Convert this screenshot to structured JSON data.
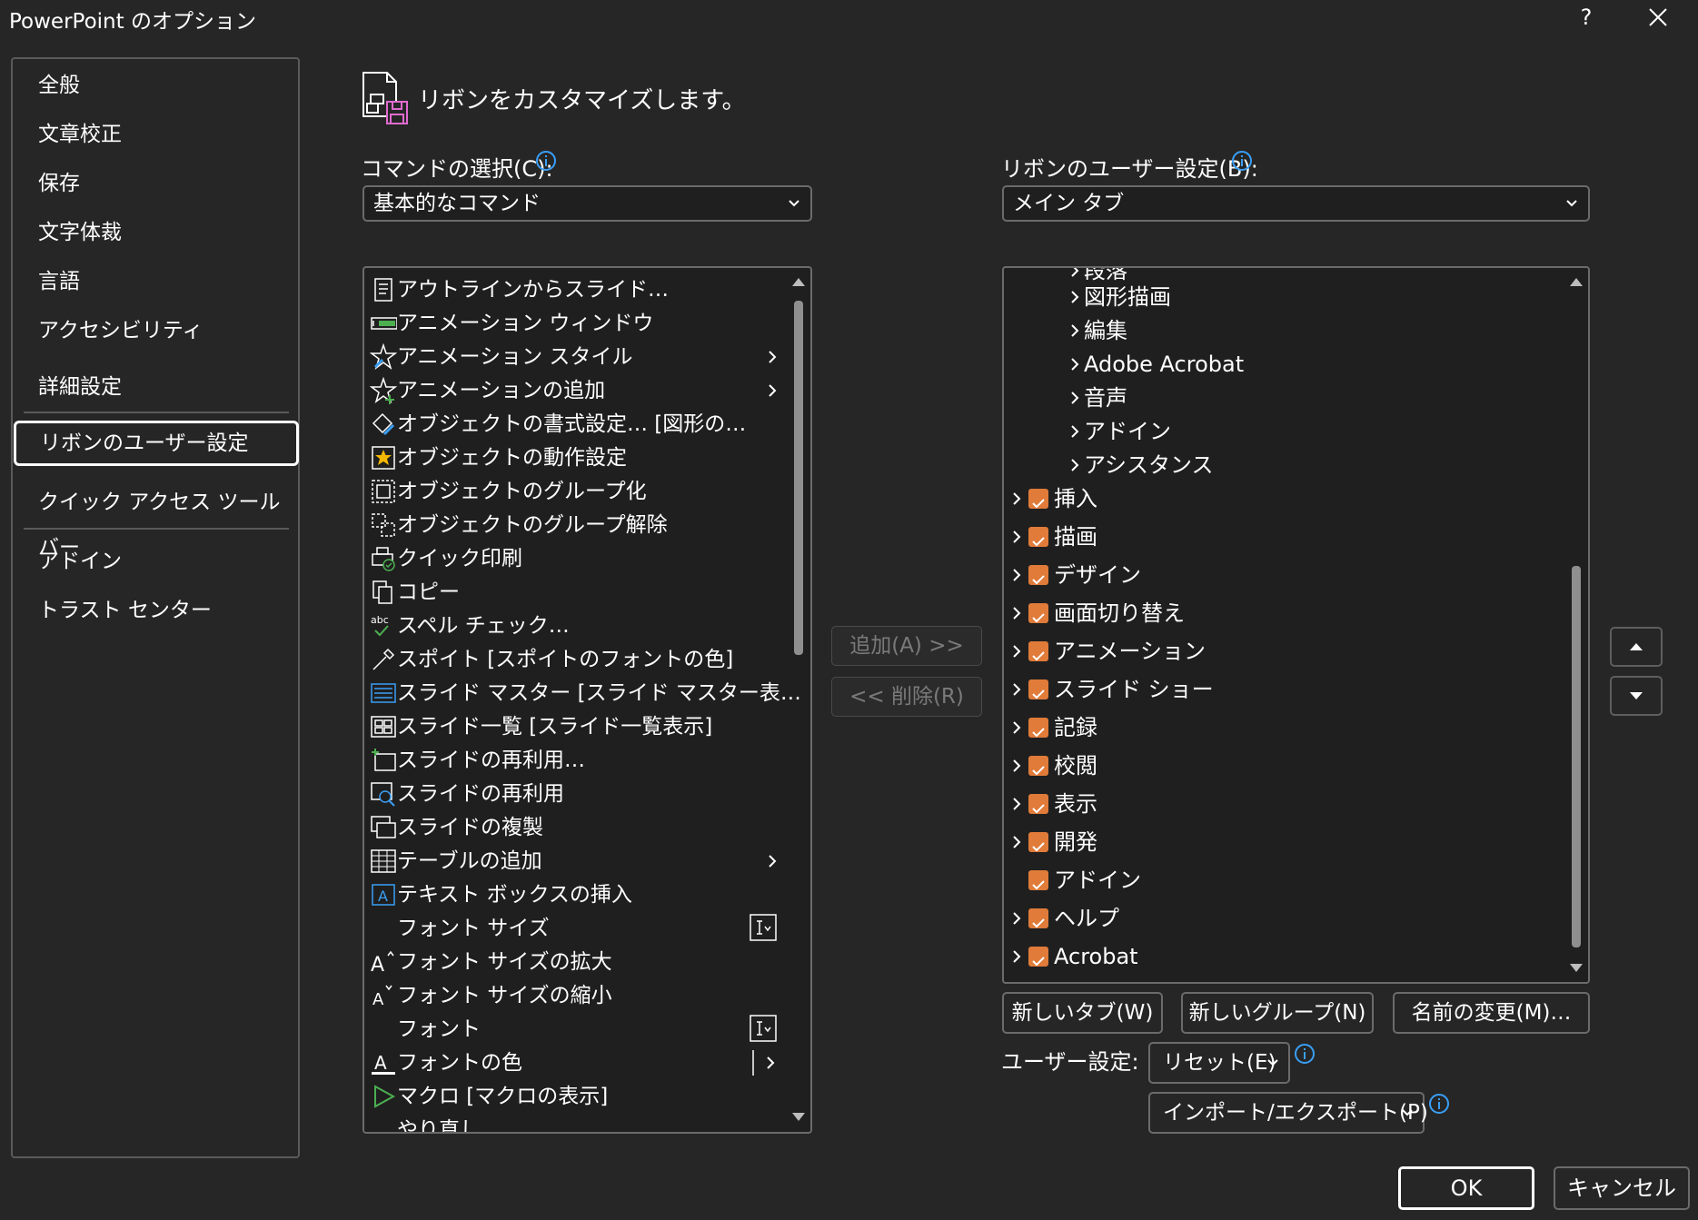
{
  "window": {
    "title": "PowerPoint のオプション",
    "help_label": "?"
  },
  "nav": {
    "items": [
      {
        "label": "全般"
      },
      {
        "label": "文章校正"
      },
      {
        "label": "保存"
      },
      {
        "label": "文字体裁"
      },
      {
        "label": "言語"
      },
      {
        "label": "アクセシビリティ"
      },
      {
        "label": "詳細設定"
      },
      {
        "label": "リボンのユーザー設定",
        "selected": true
      },
      {
        "label": "クイック アクセス ツール バー"
      },
      {
        "label": "アドイン"
      },
      {
        "label": "トラスト センター"
      }
    ]
  },
  "header": {
    "title": "リボンをカスタマイズします。"
  },
  "commands": {
    "label": "コマンドの選択(C):",
    "dropdown_value": "基本的なコマンド",
    "items": [
      {
        "label": "アウトラインからスライド…",
        "icon": "outline-icon"
      },
      {
        "label": "アニメーション ウィンドウ",
        "icon": "animation-pane-icon"
      },
      {
        "label": "アニメーション スタイル",
        "icon": "animation-style-icon",
        "submenu": true
      },
      {
        "label": "アニメーションの追加",
        "icon": "add-animation-icon",
        "submenu": true
      },
      {
        "label": "オブジェクトの書式設定… [図形の…",
        "icon": "format-object-icon"
      },
      {
        "label": "オブジェクトの動作設定",
        "icon": "action-icon"
      },
      {
        "label": "オブジェクトのグループ化",
        "icon": "group-icon"
      },
      {
        "label": "オブジェクトのグループ解除",
        "icon": "ungroup-icon"
      },
      {
        "label": "クイック印刷",
        "icon": "quick-print-icon"
      },
      {
        "label": "コピー",
        "icon": "copy-icon"
      },
      {
        "label": "スペル チェック…",
        "icon": "spellcheck-icon"
      },
      {
        "label": "スポイト [スポイトのフォントの色]",
        "icon": "eyedropper-icon"
      },
      {
        "label": "スライド マスター [スライド マスター表…",
        "icon": "slide-master-icon"
      },
      {
        "label": "スライド一覧 [スライド一覧表示]",
        "icon": "slide-sorter-icon"
      },
      {
        "label": "スライドの再利用…",
        "icon": "reuse-slides-icon"
      },
      {
        "label": "スライドの再利用",
        "icon": "reuse-slides-search-icon"
      },
      {
        "label": "スライドの複製",
        "icon": "duplicate-slide-icon"
      },
      {
        "label": "テーブルの追加",
        "icon": "table-icon",
        "submenu": true
      },
      {
        "label": "テキスト ボックスの挿入",
        "icon": "textbox-icon"
      },
      {
        "label": "フォント サイズ",
        "icon": "",
        "fieldbox": true
      },
      {
        "label": "フォント サイズの拡大",
        "icon": "font-grow-icon"
      },
      {
        "label": "フォント サイズの縮小",
        "icon": "font-shrink-icon"
      },
      {
        "label": "フォント",
        "icon": "",
        "fieldbox": true
      },
      {
        "label": "フォントの色",
        "icon": "font-color-icon",
        "split": true
      },
      {
        "label": "マクロ [マクロの表示]",
        "icon": "macro-icon"
      },
      {
        "label": "やり直し",
        "icon": ""
      }
    ]
  },
  "middle": {
    "add_label": "追加(A) >>",
    "remove_label": "<< 削除(R)"
  },
  "ribbon": {
    "label": "リボンのユーザー設定(B):",
    "dropdown_value": "メイン タブ",
    "partial_row": "段落",
    "groups": [
      {
        "label": "図形描画"
      },
      {
        "label": "編集"
      },
      {
        "label": "Adobe Acrobat"
      },
      {
        "label": "音声"
      },
      {
        "label": "アドイン"
      },
      {
        "label": "アシスタンス"
      }
    ],
    "tabs": [
      {
        "label": "挿入",
        "checked": true,
        "expandable": true
      },
      {
        "label": "描画",
        "checked": true,
        "expandable": true
      },
      {
        "label": "デザイン",
        "checked": true,
        "expandable": true
      },
      {
        "label": "画面切り替え",
        "checked": true,
        "expandable": true
      },
      {
        "label": "アニメーション",
        "checked": true,
        "expandable": true
      },
      {
        "label": "スライド ショー",
        "checked": true,
        "expandable": true
      },
      {
        "label": "記録",
        "checked": true,
        "expandable": true
      },
      {
        "label": "校閲",
        "checked": true,
        "expandable": true
      },
      {
        "label": "表示",
        "checked": true,
        "expandable": true
      },
      {
        "label": "開発",
        "checked": true,
        "expandable": true
      },
      {
        "label": "アドイン",
        "checked": true,
        "expandable": false
      },
      {
        "label": "ヘルプ",
        "checked": true,
        "expandable": true
      },
      {
        "label": "Acrobat",
        "checked": true,
        "expandable": true
      }
    ],
    "new_tab_label": "新しいタブ(W)",
    "new_group_label": "新しいグループ(N)",
    "rename_label": "名前の変更(M)…",
    "user_settings_label": "ユーザー設定:",
    "reset_label": "リセット(E)",
    "import_export_label": "インポート/エクスポート(P)"
  },
  "footer": {
    "ok_label": "OK",
    "cancel_label": "キャンセル"
  },
  "colors": {
    "background": "#262626",
    "list_background": "#1f1f1f",
    "checkbox": "#e07b39",
    "info": "#3a9ff5"
  }
}
